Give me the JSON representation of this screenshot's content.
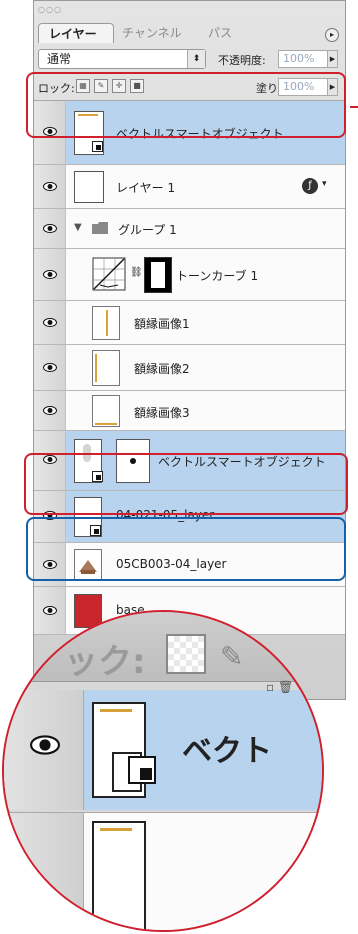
{
  "panel": {
    "tabs": [
      {
        "label": "レイヤー"
      },
      {
        "label": "チャンネル"
      },
      {
        "label": "パス"
      }
    ],
    "menu_icon": "panel-menu-icon"
  },
  "controls": {
    "blend_mode": "通常",
    "opacity_label": "不透明度:",
    "opacity_value": "100%",
    "lock_label": "ロック:",
    "fill_label": "塗り:",
    "fill_value": "100%"
  },
  "layers": [
    {
      "name": "ベクトルスマートオブジェクト",
      "type": "smart-object",
      "selected": true
    },
    {
      "name": "レイヤー 1",
      "type": "pixel",
      "selected": false
    },
    {
      "name": "グループ 1",
      "type": "group",
      "selected": false
    },
    {
      "name": "トーンカーブ 1",
      "type": "adjustment",
      "selected": false
    },
    {
      "name": "額縁画像1",
      "type": "pixel",
      "selected": false
    },
    {
      "name": "額縁画像2",
      "type": "pixel",
      "selected": false
    },
    {
      "name": "額縁画像3",
      "type": "pixel",
      "selected": false
    },
    {
      "name": "ベクトルスマートオブジェクト",
      "type": "smart-object-masked",
      "selected": true
    },
    {
      "name": "04-021-05_layer",
      "type": "smart-object",
      "selected": true
    },
    {
      "name": "05CB003-04_layer",
      "type": "pixel",
      "selected": false
    },
    {
      "name": "base",
      "type": "pixel",
      "selected": false
    }
  ],
  "colors": {
    "selection": "#b7d3ee",
    "callout_red": "#d0202e",
    "callout_blue": "#1560a8",
    "base_swatch": "#c8262c"
  },
  "magnifier": {
    "lock_text": "ック:",
    "layer_text": "ベクト"
  }
}
